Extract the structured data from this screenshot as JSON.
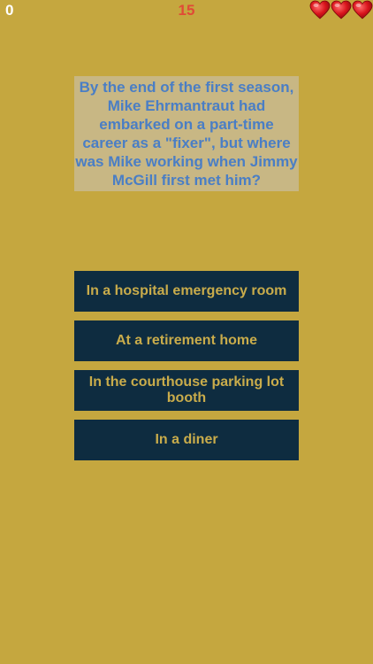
{
  "hud": {
    "score": "0",
    "timer": "15",
    "lives": 3,
    "life_icon": "heart-icon",
    "colors": {
      "background": "#c5a73f",
      "timer": "#e04a36",
      "heart": "#d9141c"
    }
  },
  "question": {
    "text": "By the end of the first season, Mike Ehrmantraut had embarked on a part-time career as a \"fixer\", but where was Mike working when Jimmy McGill first met him?",
    "text_color": "#4a7ec5",
    "box_color": "#c8b784"
  },
  "answers": [
    {
      "label": "In a hospital emergency room"
    },
    {
      "label": "At a retirement home"
    },
    {
      "label": "In the courthouse parking lot booth"
    },
    {
      "label": "In a diner"
    }
  ],
  "answer_style": {
    "background": "#0e2c40",
    "text_color": "#c9ac4b"
  }
}
